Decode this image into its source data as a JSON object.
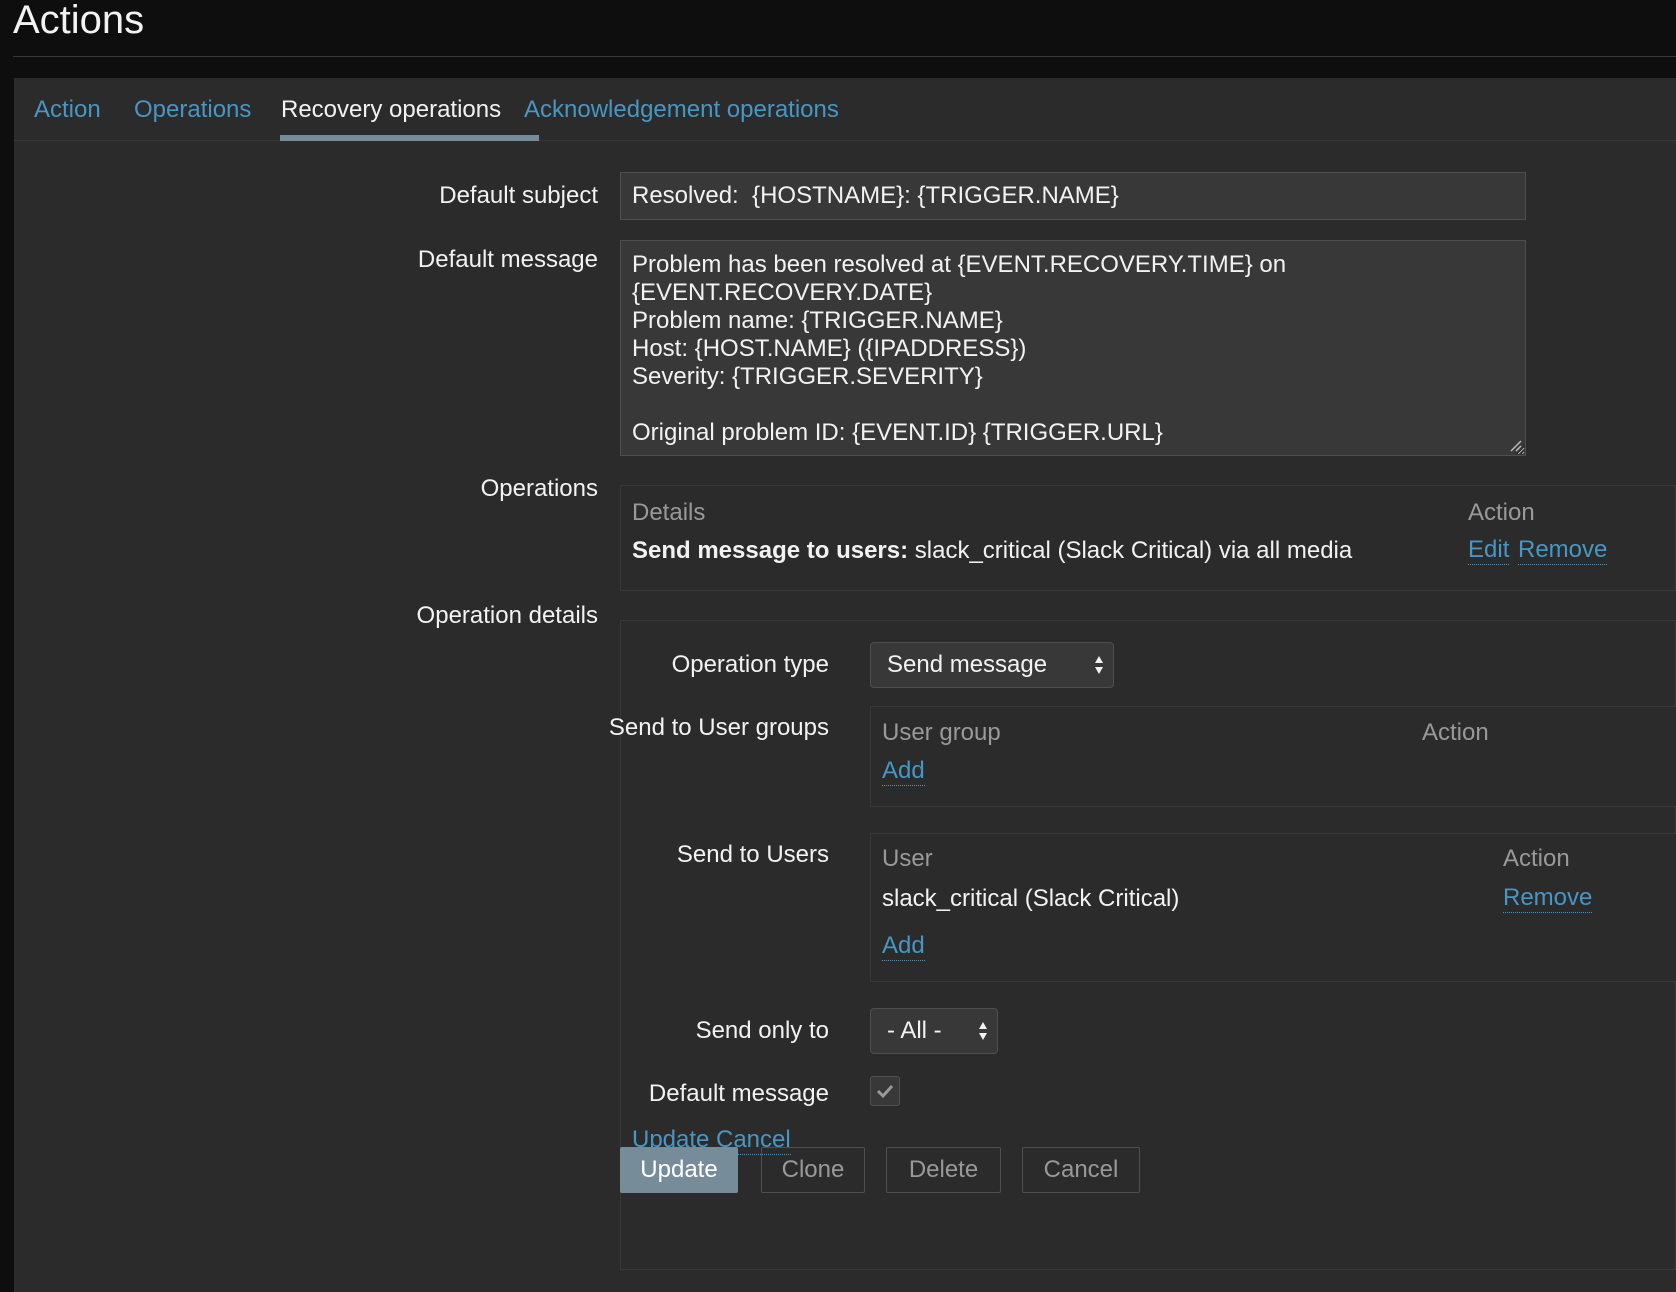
{
  "page": {
    "title": "Actions"
  },
  "tabs": [
    {
      "label": "Action",
      "active": false
    },
    {
      "label": "Operations",
      "active": false
    },
    {
      "label": "Recovery operations",
      "active": true
    },
    {
      "label": "Acknowledgement operations",
      "active": false
    }
  ],
  "form": {
    "subject_label": "Default subject",
    "subject_value": "Resolved:  {HOSTNAME}: {TRIGGER.NAME}",
    "message_label": "Default message",
    "message_value": "Problem has been resolved at {EVENT.RECOVERY.TIME} on\n{EVENT.RECOVERY.DATE}\nProblem name: {TRIGGER.NAME}\nHost: {HOST.NAME} ({IPADDRESS})\nSeverity: {TRIGGER.SEVERITY}\n\nOriginal problem ID: {EVENT.ID} {TRIGGER.URL}",
    "operations_label": "Operations",
    "operation_details_label": "Operation details"
  },
  "operations": {
    "col_details": "Details",
    "col_action": "Action",
    "row": {
      "bold": "Send message to users:",
      "rest": " slack_critical (Slack Critical) via all media",
      "edit": "Edit",
      "remove": "Remove"
    }
  },
  "operation_details": {
    "type_label": "Operation type",
    "type_value": "Send message",
    "user_groups_label": "Send to User groups",
    "user_groups": {
      "col_group": "User group",
      "col_action": "Action",
      "add": "Add"
    },
    "users_label": "Send to Users",
    "users": {
      "col_user": "User",
      "col_action": "Action",
      "rows": [
        {
          "name": "slack_critical (Slack Critical)",
          "action": "Remove"
        }
      ],
      "add": "Add"
    },
    "send_only_label": "Send only to",
    "send_only_value": "- All -",
    "default_message_label": "Default message",
    "default_message_checked": true,
    "update_link": "Update",
    "cancel_link": "Cancel"
  },
  "buttons": {
    "update": "Update",
    "clone": "Clone",
    "delete": "Delete",
    "cancel": "Cancel"
  },
  "colors": {
    "link": "#4796c4",
    "background": "#2b2b2b",
    "primary_button": "#768d99"
  }
}
